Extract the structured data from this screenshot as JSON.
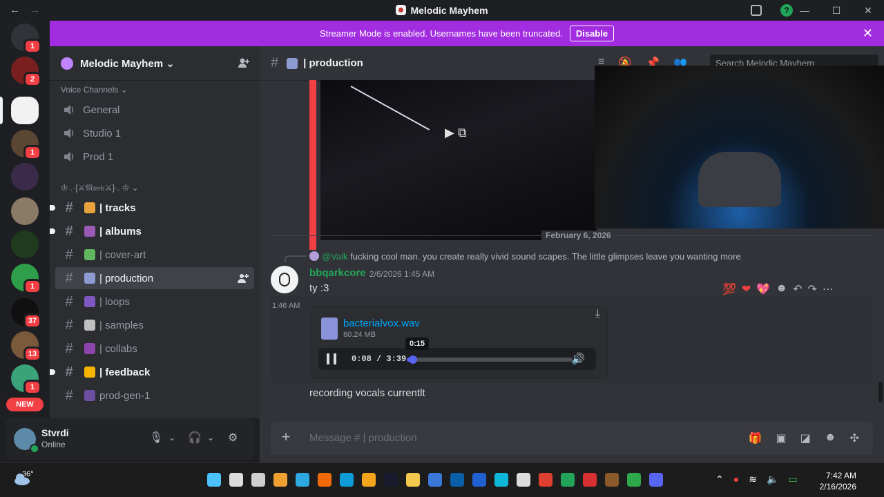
{
  "window": {
    "title": "Melodic Mayhem",
    "back": "←",
    "forward": "→",
    "minimize": "—",
    "maximize": "☐",
    "close": "✕",
    "help": "?"
  },
  "banner": {
    "text": "Streamer Mode is enabled. Usernames have been truncated.",
    "button": "Disable",
    "close": "✕"
  },
  "servers": [
    {
      "name": "discord-home",
      "color": "#313338",
      "badge": "1"
    },
    {
      "name": "server-red-avatar",
      "color": "#7a1f1f",
      "badge": "2"
    },
    {
      "name": "melodic-mayhem",
      "color": "#f2f2f2",
      "badge": ""
    },
    {
      "name": "server-gold-crest",
      "color": "#5a4632",
      "badge": "1"
    },
    {
      "name": "server-galaxy",
      "color": "#3b2a4a",
      "badge": ""
    },
    {
      "name": "server-tan",
      "color": "#8a7a66",
      "badge": ""
    },
    {
      "name": "server-cashcow",
      "color": "#1e3b1e",
      "badge": ""
    },
    {
      "name": "server-green-char",
      "color": "#2f9e4a",
      "badge": "1"
    },
    {
      "name": "server-skilladines",
      "color": "#101010",
      "badge": "37"
    },
    {
      "name": "server-brown",
      "color": "#7a5a3a",
      "badge": "13"
    },
    {
      "name": "server-keyboard",
      "color": "#3aa37a",
      "badge": "1"
    }
  ],
  "new_pill": "NEW",
  "guild": {
    "name": "Melodic Mayhem ⌄"
  },
  "categories": {
    "voice": "Voice Channels ⌄",
    "music": "♔ .·[⚔𝔐𝔲𝔰𝔦𝔠⚔]·. ♔ ⌄"
  },
  "voice_channels": [
    {
      "name": "General"
    },
    {
      "name": "Studio 1"
    },
    {
      "name": "Prod 1"
    }
  ],
  "text_channels": [
    {
      "name": "| tracks",
      "emoji_color": "#e8a33d",
      "unread": true
    },
    {
      "name": "| albums",
      "emoji_color": "#9b59b6",
      "unread": true
    },
    {
      "name": "| cover-art",
      "emoji_color": "#5fb85f",
      "unread": false
    },
    {
      "name": "| production",
      "emoji_color": "#8e9bd3",
      "unread": false,
      "active": true
    },
    {
      "name": "| loops",
      "emoji_color": "#7e57c2",
      "unread": false
    },
    {
      "name": "| samples",
      "emoji_color": "#c0c0c0",
      "unread": false
    },
    {
      "name": "| collabs",
      "emoji_color": "#8e44ad",
      "unread": false
    },
    {
      "name": "| feedback",
      "emoji_color": "#f4b400",
      "unread": true
    },
    {
      "name": "prod-gen-1",
      "emoji_color": "#6c4fa0",
      "unread": false
    }
  ],
  "user": {
    "name": "Stvrdi",
    "status": "Online"
  },
  "channel_header": {
    "name": "| production",
    "search_placeholder": "Search Melodic Mayhem"
  },
  "date_divider": "February 6, 2026",
  "reply": {
    "mention": "@Valk",
    "text": " fucking cool man. you create really vivid sound scapes. The little glimpses leave you wanting more"
  },
  "message1": {
    "author": "bbqarkcore",
    "timestamp": "2/6/2026 1:45 AM",
    "text": "ty :3"
  },
  "reactions": [
    "💯",
    "❤",
    "💖",
    "☻",
    "↶",
    "↷",
    "⋯"
  ],
  "message2": {
    "timestamp": "1:46 AM",
    "file_name": "bacterialvox.wav",
    "file_size": "60.24 MB",
    "current_time": "0:08",
    "duration": "3:39",
    "time_display": "0:08 / 3:39",
    "progress": 0.037,
    "tooltip": "0:15"
  },
  "message3": {
    "text": "recording vocals currentlt"
  },
  "composer": {
    "placeholder": "Message # | production"
  },
  "taskbar": {
    "temperature": "36°",
    "time": "7:42 AM",
    "date": "2/16/2026"
  }
}
